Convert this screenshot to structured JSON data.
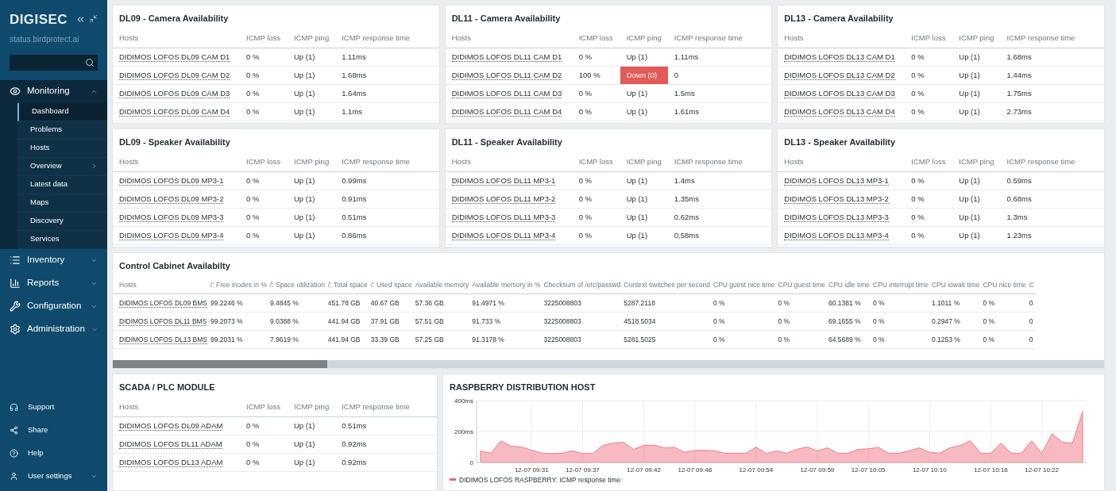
{
  "sidebar": {
    "logo": "DIGISEC",
    "subtitle": "status.birdprotect.ai",
    "menu": [
      {
        "label": "Monitoring",
        "expanded": true,
        "children": [
          {
            "label": "Dashboard",
            "selected": true,
            "submenu": false
          },
          {
            "label": "Problems",
            "selected": false,
            "submenu": false
          },
          {
            "label": "Hosts",
            "selected": false,
            "submenu": false
          },
          {
            "label": "Overview",
            "selected": false,
            "submenu": true
          },
          {
            "label": "Latest data",
            "selected": false,
            "submenu": false
          },
          {
            "label": "Maps",
            "selected": false,
            "submenu": false
          },
          {
            "label": "Discovery",
            "selected": false,
            "submenu": false
          },
          {
            "label": "Services",
            "selected": false,
            "submenu": false
          }
        ]
      },
      {
        "label": "Inventory",
        "expanded": false
      },
      {
        "label": "Reports",
        "expanded": false
      },
      {
        "label": "Configuration",
        "expanded": false
      },
      {
        "label": "Administration",
        "expanded": false
      }
    ],
    "footer": [
      {
        "label": "Support",
        "submenu": false
      },
      {
        "label": "Share",
        "submenu": false
      },
      {
        "label": "Help",
        "submenu": false
      },
      {
        "label": "User settings",
        "submenu": true
      }
    ]
  },
  "widgets": [
    {
      "title": "DL09 - Camera Availability",
      "columns": [
        "Hosts",
        "ICMP loss",
        "ICMP ping",
        "ICMP response time"
      ],
      "rows": [
        {
          "cells": [
            "DIDIMOS LOFOS DL09 CAM D1",
            "0 %",
            "Up (1)",
            "1.11ms"
          ],
          "alert": false
        },
        {
          "cells": [
            "DIDIMOS LOFOS DL09 CAM D2",
            "0 %",
            "Up (1)",
            "1.68ms"
          ],
          "alert": false
        },
        {
          "cells": [
            "DIDIMOS LOFOS DL09 CAM D3",
            "0 %",
            "Up (1)",
            "1.64ms"
          ],
          "alert": false
        },
        {
          "cells": [
            "DIDIMOS LOFOS DL09 CAM D4",
            "0 %",
            "Up (1)",
            "1.1ms"
          ],
          "alert": false
        }
      ]
    },
    {
      "title": "DL11 - Camera Availability",
      "columns": [
        "Hosts",
        "ICMP loss",
        "ICMP ping",
        "ICMP response time"
      ],
      "rows": [
        {
          "cells": [
            "DIDIMOS LOFOS DL11 CAM D1",
            "0 %",
            "Up (1)",
            "1.11ms"
          ],
          "alert": false
        },
        {
          "cells": [
            "DIDIMOS LOFOS DL11 CAM D2",
            "100 %",
            "Down (0)",
            "0"
          ],
          "alert": true
        },
        {
          "cells": [
            "DIDIMOS LOFOS DL11 CAM D3",
            "0 %",
            "Up (1)",
            "1.5ms"
          ],
          "alert": false
        },
        {
          "cells": [
            "DIDIMOS LOFOS DL11 CAM D4",
            "0 %",
            "Up (1)",
            "1.61ms"
          ],
          "alert": false
        }
      ]
    },
    {
      "title": "DL13 - Camera Availability",
      "columns": [
        "Hosts",
        "ICMP loss",
        "ICMP ping",
        "ICMP response time"
      ],
      "rows": [
        {
          "cells": [
            "DIDIMOS LOFOS DL13 CAM D1",
            "0 %",
            "Up (1)",
            "1.68ms"
          ],
          "alert": false
        },
        {
          "cells": [
            "DIDIMOS LOFOS DL13 CAM D2",
            "0 %",
            "Up (1)",
            "1.44ms"
          ],
          "alert": false
        },
        {
          "cells": [
            "DIDIMOS LOFOS DL13 CAM D3",
            "0 %",
            "Up (1)",
            "1.75ms"
          ],
          "alert": false
        },
        {
          "cells": [
            "DIDIMOS LOFOS DL13 CAM D4",
            "0 %",
            "Up (1)",
            "2.73ms"
          ],
          "alert": false
        }
      ]
    },
    {
      "title": "DL09 - Speaker Availability",
      "columns": [
        "Hosts",
        "ICMP loss",
        "ICMP ping",
        "ICMP response time"
      ],
      "rows": [
        {
          "cells": [
            "DIDIMOS LOFOS DL09 MP3-1",
            "0 %",
            "Up (1)",
            "0.99ms"
          ],
          "alert": false
        },
        {
          "cells": [
            "DIDIMOS LOFOS DL09 MP3-2",
            "0 %",
            "Up (1)",
            "0.91ms"
          ],
          "alert": false
        },
        {
          "cells": [
            "DIDIMOS LOFOS DL09 MP3-3",
            "0 %",
            "Up (1)",
            "0.51ms"
          ],
          "alert": false
        },
        {
          "cells": [
            "DIDIMOS LOFOS DL09 MP3-4",
            "0 %",
            "Up (1)",
            "0.86ms"
          ],
          "alert": false
        }
      ]
    },
    {
      "title": "DL11 - Speaker Availability",
      "columns": [
        "Hosts",
        "ICMP loss",
        "ICMP ping",
        "ICMP response time"
      ],
      "rows": [
        {
          "cells": [
            "DIDIMOS LOFOS DL11 MP3-1",
            "0 %",
            "Up (1)",
            "1.4ms"
          ],
          "alert": false
        },
        {
          "cells": [
            "DIDIMOS LOFOS DL11 MP3-2",
            "0 %",
            "Up (1)",
            "1.35ms"
          ],
          "alert": false
        },
        {
          "cells": [
            "DIDIMOS LOFOS DL11 MP3-3",
            "0 %",
            "Up (1)",
            "0.62ms"
          ],
          "alert": false
        },
        {
          "cells": [
            "DIDIMOS LOFOS DL11 MP3-4",
            "0 %",
            "Up (1)",
            "0.58ms"
          ],
          "alert": false
        }
      ]
    },
    {
      "title": "DL13 - Speaker Availability",
      "columns": [
        "Hosts",
        "ICMP loss",
        "ICMP ping",
        "ICMP response time"
      ],
      "rows": [
        {
          "cells": [
            "DIDIMOS LOFOS DL13 MP3-1",
            "0 %",
            "Up (1)",
            "0.59ms"
          ],
          "alert": false
        },
        {
          "cells": [
            "DIDIMOS LOFOS DL13 MP3-2",
            "0 %",
            "Up (1)",
            "0.68ms"
          ],
          "alert": false
        },
        {
          "cells": [
            "DIDIMOS LOFOS DL13 MP3-3",
            "0 %",
            "Up (1)",
            "1.3ms"
          ],
          "alert": false
        },
        {
          "cells": [
            "DIDIMOS LOFOS DL13 MP3-4",
            "0 %",
            "Up (1)",
            "1.23ms"
          ],
          "alert": false
        }
      ]
    }
  ],
  "cabinet": {
    "title": "Control Cabinet Availabilty",
    "columns": [
      "Hosts",
      "/: Free inodes in %",
      "/: Space utilization",
      "/: Total space",
      "/: Used space",
      "Available memory",
      "Available memory in %",
      "Checksum of /etc/passwd",
      "Context switches per second",
      "CPU guest nice time",
      "CPU guest time",
      "CPU idle time",
      "CPU interrupt time",
      "CPU iowait time",
      "CPU nice time",
      "C"
    ],
    "rows": [
      [
        "DIDIMOS LOFOS DL09 BMS",
        "99.2246 %",
        "9.4845 %",
        "451.78 GB",
        "40.67 GB",
        "57.36 GB",
        "91.4971 %",
        "3225008803",
        "5287.2118",
        "0 %",
        "0 %",
        "60.1381 %",
        "0 %",
        "1.1011 %",
        "0 %",
        "0"
      ],
      [
        "DIDIMOS LOFOS DL11 BMS",
        "99.2073 %",
        "9.0388 %",
        "441.94 GB",
        "37.91 GB",
        "57.51 GB",
        "91.733 %",
        "3225008803",
        "4518.5034",
        "0 %",
        "0 %",
        "69.1655 %",
        "0 %",
        "0.2947 %",
        "0 %",
        "0"
      ],
      [
        "DIDIMOS LOFOS DL13 BMS",
        "99.2031 %",
        "7.9619 %",
        "441.94 GB",
        "33.39 GB",
        "57.25 GB",
        "91.3178 %",
        "3225008803",
        "5281.5025",
        "0 %",
        "0 %",
        "64.5689 %",
        "0 %",
        "0.1253 %",
        "0 %",
        "0"
      ]
    ]
  },
  "scada": {
    "title": "SCADA / PLC MODULE",
    "columns": [
      "Hosts",
      "ICMP loss",
      "ICMP ping",
      "ICMP response time"
    ],
    "rows": [
      {
        "cells": [
          "DIDIMOS LOFOS DL09 ADAM",
          "0 %",
          "Up (1)",
          "0.51ms"
        ],
        "alert": false
      },
      {
        "cells": [
          "DIDIMOS LOFOS DL11 ADAM",
          "0 %",
          "Up (1)",
          "0.92ms"
        ],
        "alert": false
      },
      {
        "cells": [
          "DIDIMOS LOFOS DL13 ADAM",
          "0 %",
          "Up (1)",
          "0.92ms"
        ],
        "alert": false
      }
    ]
  },
  "graph": {
    "title": "RASPBERRY DISTRIBUTION HOST",
    "chart_data": {
      "type": "area",
      "ylim": [
        0,
        400
      ],
      "grid": true,
      "categories": [
        null,
        null,
        null,
        null,
        null,
        "12-07 09:31",
        null,
        null,
        null,
        null,
        "12-07 09:37",
        null,
        null,
        null,
        null,
        null,
        "12-07 09:42",
        null,
        null,
        null,
        null,
        "12-07 09:48",
        null,
        null,
        null,
        null,
        null,
        "12-07 09:54",
        null,
        null,
        null,
        null,
        null,
        "12-07 09:59",
        null,
        null,
        null,
        null,
        "12-07 10:05",
        null,
        null,
        null,
        null,
        null,
        "12-07 10:10",
        null,
        null,
        null,
        null,
        null,
        "12-07 10:16",
        null,
        null,
        null,
        null,
        "12-07 10:22",
        null,
        null,
        null,
        null
      ],
      "yticks": [
        0,
        {
          "value": 200,
          "label": "200ms"
        },
        {
          "value": 400,
          "label": "400ms"
        }
      ],
      "series": [
        {
          "name": "DIDIMOS LOFOS RASPBERRY: ICMP response time",
          "color": "#f06477",
          "values": [
            75,
            60,
            140,
            105,
            100,
            80,
            60,
            58,
            60,
            75,
            58,
            58,
            110,
            125,
            130,
            85,
            110,
            112,
            95,
            98,
            65,
            78,
            78,
            75,
            60,
            60,
            60,
            100,
            58,
            75,
            60,
            85,
            100,
            75,
            95,
            60,
            60,
            85,
            88,
            98,
            60,
            60,
            75,
            95,
            65,
            60,
            95,
            110,
            140,
            60,
            60,
            125,
            60,
            60,
            140,
            60,
            185,
            130,
            125,
            330
          ]
        }
      ]
    }
  }
}
